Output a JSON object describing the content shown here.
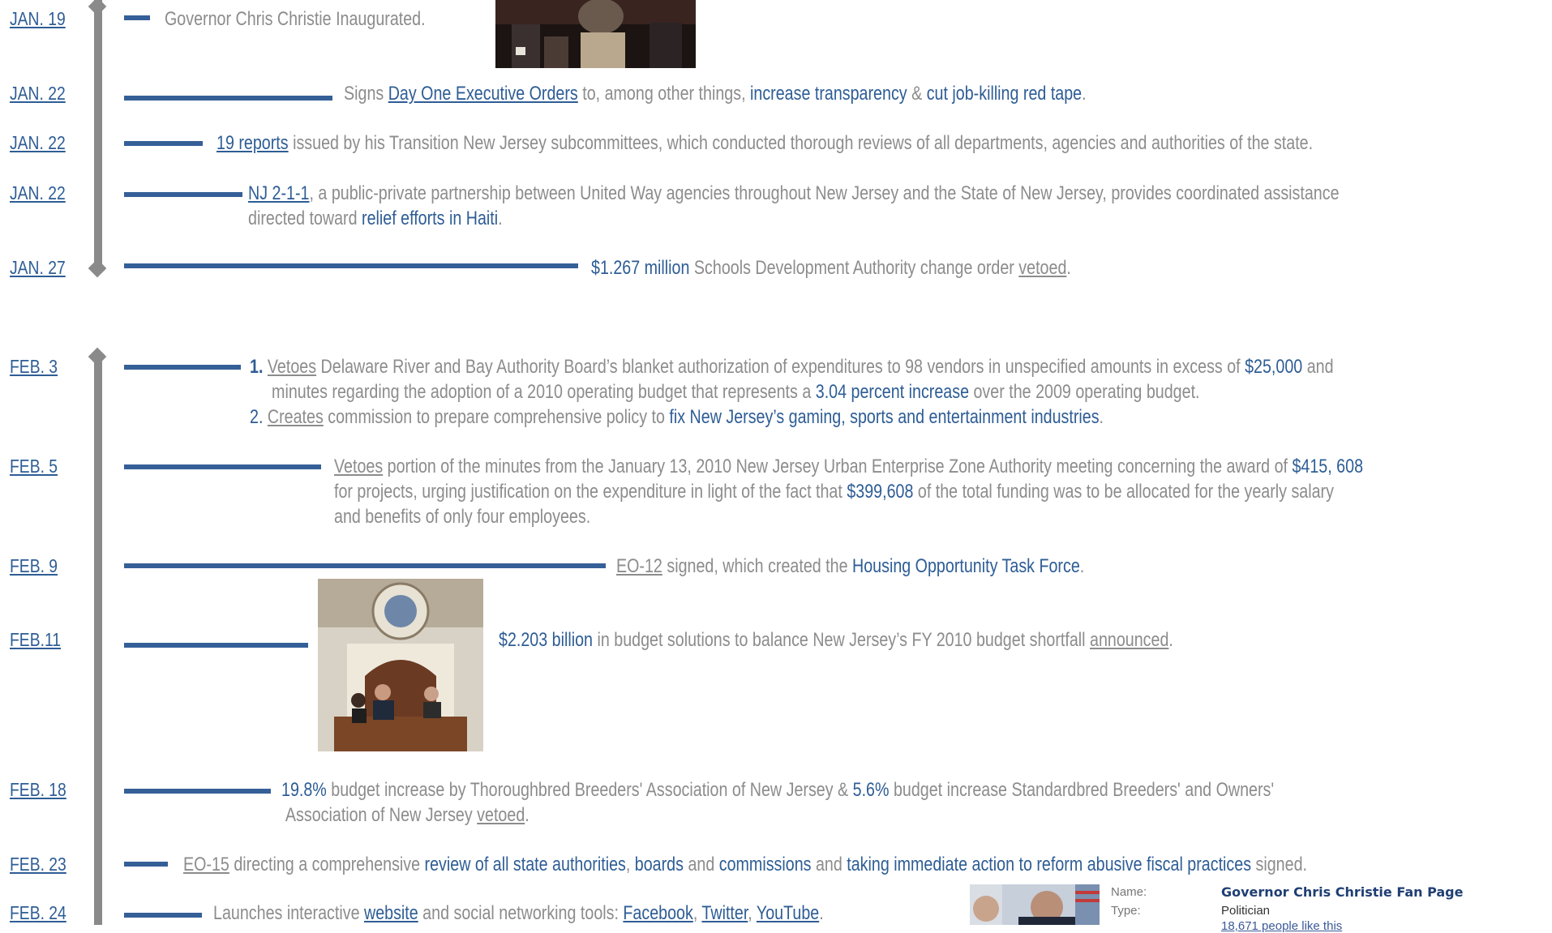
{
  "timeline": {
    "jan19": {
      "date": "JAN. 19",
      "text": "Governor Chris Christie Inaugurated."
    },
    "jan22a": {
      "date": "JAN. 22",
      "p1": "Signs ",
      "link1": "Day One Executive Orders",
      "p2": " to, among other things, ",
      "hl1": "increase transparency",
      "p3": " & ",
      "hl2": "cut job-killing red tape",
      "p4": "."
    },
    "jan22b": {
      "date": "JAN. 22",
      "link1": "19 reports",
      "p1": " issued by his Transition New Jersey subcommittees, which conducted thorough reviews of all departments, agencies and authorities of the state."
    },
    "jan22c": {
      "date": "JAN. 22",
      "link1": "NJ 2-1-1",
      "p1": ", a public-private partnership between United Way agencies throughout New Jersey and the State of New Jersey, provides coordinated assistance",
      "p2": "directed toward ",
      "hl1": "relief efforts in Haiti",
      "p3": "."
    },
    "jan27": {
      "date": "JAN. 27",
      "hl1": "$1.267 million",
      "p1": " Schools Development Authority change order ",
      "u1": "vetoed",
      "p2": "."
    },
    "feb3": {
      "date": "FEB. 3",
      "n1": "1.",
      "u1": "Vetoes",
      "p1": " Delaware River and Bay Authority Board’s blanket authorization of expenditures to 98 vendors in unspecified amounts in excess of ",
      "hl1": "$25,000",
      "p2": " and",
      "p3": "minutes regarding the adoption of a 2010 operating budget that represents a ",
      "hl2": "3.04 percent increase",
      "p4": " over the 2009 operating budget.",
      "n2": "2.",
      "u2": "Creates",
      "p5": " commission to prepare comprehensive policy to ",
      "hl3": "fix New Jersey’s gaming, sports and entertainment industries",
      "p6": "."
    },
    "feb5": {
      "date": "FEB. 5",
      "u1": "Vetoes",
      "p1": " portion of the minutes from the January 13, 2010 New Jersey Urban Enterprise Zone Authority meeting concerning the award of ",
      "hl1": "$415, 608",
      "p2": "for projects, urging justification on the expenditure in light of the fact that ",
      "hl2": "$399,608",
      "p3": " of the total funding was to be allocated for the yearly salary",
      "p4": "and benefits of only four employees."
    },
    "feb9": {
      "date": "FEB. 9",
      "u1": "EO-12",
      "p1": " signed, which created the ",
      "hl1": "Housing Opportunity Task Force",
      "p2": "."
    },
    "feb11": {
      "date": "FEB.11",
      "hl1": "$2.203 billion",
      "p1": " in budget solutions to balance New Jersey’s FY 2010 budget shortfall ",
      "u1": "announced",
      "p2": "."
    },
    "feb18": {
      "date": "FEB. 18",
      "hl1": "19.8%",
      "p1": " budget increase by Thoroughbred Breeders' Association of New Jersey & ",
      "hl2": "5.6%",
      "p2": " budget increase Standardbred Breeders' and Owners'",
      "p3": "Association of New Jersey ",
      "u1": "vetoed",
      "p4": "."
    },
    "feb23": {
      "date": "FEB. 23",
      "u1": "EO-15",
      "p1": " directing a comprehensive ",
      "hl1": "review of all state authorities",
      "p2": ", ",
      "hl2": "boards",
      "p3": " and ",
      "hl3": "commissions",
      "p4": " and ",
      "hl4": "taking immediate action to reform abusive fiscal practices",
      "p5": " signed."
    },
    "feb24": {
      "date": "FEB. 24",
      "p1": "Launches interactive ",
      "link1": "website",
      "p2": " and social networking tools: ",
      "link2": "Facebook",
      "p3": ", ",
      "link3": "Twitter",
      "p4": ", ",
      "link4": "YouTube",
      "p5": "."
    }
  },
  "fan_page": {
    "name_label": "Name:",
    "name_value": "Governor Chris Christie Fan Page",
    "type_label": "Type:",
    "type_value": "Politician",
    "likes": "18,671 people like this"
  },
  "colors": {
    "accent": "#2e5d95",
    "bar": "#355f97",
    "body_text": "#8c8c8c",
    "timeline_line": "#8a8a8a"
  }
}
